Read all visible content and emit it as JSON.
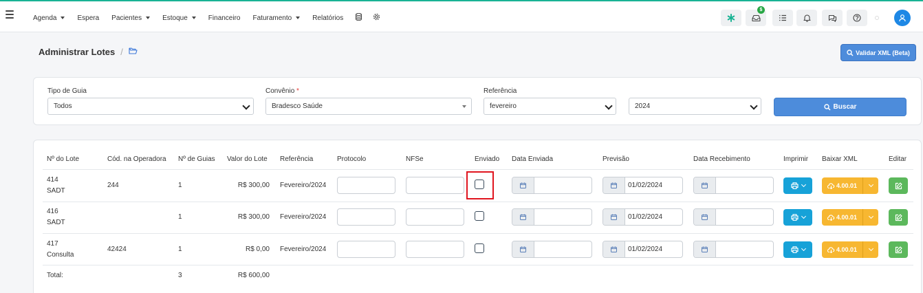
{
  "nav": {
    "items": [
      {
        "label": "Agenda",
        "dropdown": true
      },
      {
        "label": "Espera",
        "dropdown": false
      },
      {
        "label": "Pacientes",
        "dropdown": true
      },
      {
        "label": "Estoque",
        "dropdown": true
      },
      {
        "label": "Financeiro",
        "dropdown": false
      },
      {
        "label": "Faturamento",
        "dropdown": true
      },
      {
        "label": "Relatórios",
        "dropdown": false
      }
    ],
    "right_icons": [
      "asterisk-icon",
      "inbox-icon",
      "checklist-icon",
      "bell-icon",
      "chat-icon",
      "help-icon",
      "user-icon"
    ],
    "dollar_badge": "$"
  },
  "header": {
    "title": "Administrar Lotes",
    "separator": "/",
    "validar_label": "Validar XML (Beta)"
  },
  "filters": {
    "tipo_label": "Tipo de Guia",
    "tipo_value": "Todos",
    "convenio_label": "Convênio",
    "convenio_required": "*",
    "convenio_value": "Bradesco Saúde",
    "referencia_label": "Referência",
    "referencia_value": "fevereiro",
    "ano_value": "2024",
    "buscar_label": "Buscar"
  },
  "table": {
    "headers": [
      "Nº do Lote",
      "Cód. na Operadora",
      "Nº de Guias",
      "Valor do Lote",
      "Referência",
      "Protocolo",
      "NFSe",
      "Enviado",
      "Data Enviada",
      "Previsão",
      "Data Recebimento",
      "Imprimir",
      "Baixar XML",
      "Editar"
    ],
    "rows": [
      {
        "lote": "414",
        "tipo": "SADT",
        "cod": "244",
        "guias": "1",
        "valor": "R$ 300,00",
        "referencia": "Fevereiro/2024",
        "previsao": "01/02/2024",
        "xml": "4.00.01"
      },
      {
        "lote": "416",
        "tipo": "SADT",
        "cod": "",
        "guias": "1",
        "valor": "R$ 300,00",
        "referencia": "Fevereiro/2024",
        "previsao": "01/02/2024",
        "xml": "4.00.01"
      },
      {
        "lote": "417",
        "tipo": "Consulta",
        "cod": "42424",
        "guias": "1",
        "valor": "R$ 0,00",
        "referencia": "Fevereiro/2024",
        "previsao": "01/02/2024",
        "xml": "4.00.01"
      }
    ],
    "total_label": "Total:",
    "total_guias": "3",
    "total_valor": "R$ 600,00"
  },
  "colors": {
    "accent": "#19b394",
    "primary": "#4d8cdb",
    "info": "#17a2d8",
    "warning": "#f7b731",
    "success": "#5cb85c",
    "highlight": "#e0141e"
  }
}
